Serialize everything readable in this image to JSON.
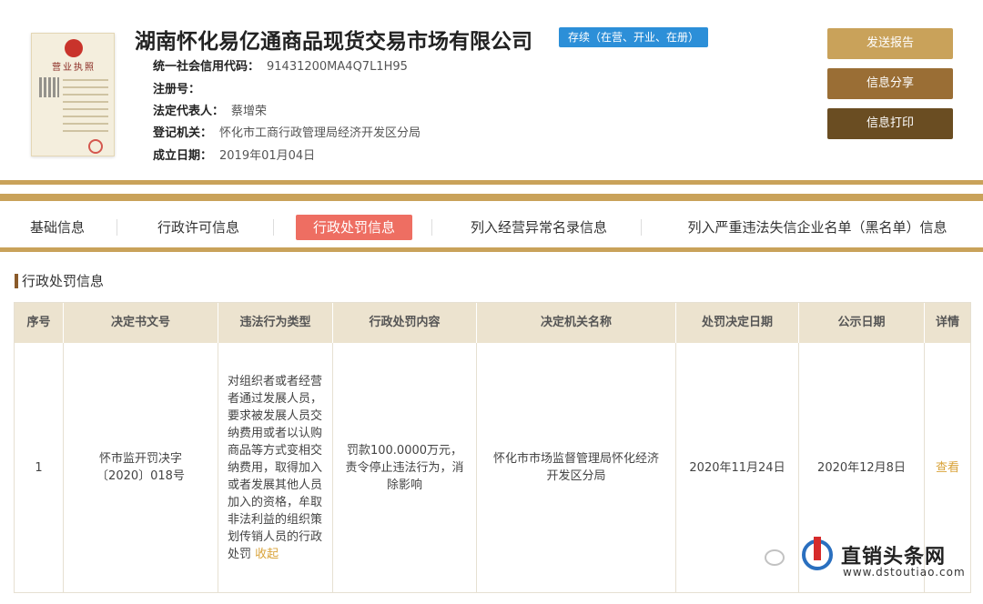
{
  "header": {
    "company_name": "湖南怀化易亿通商品现货交易市场有限公司",
    "status_badge": "存续（在营、开业、在册）",
    "license_title": "营业执照",
    "fields": [
      {
        "key": "统一社会信用代码：",
        "value": "91431200MA4Q7L1H95"
      },
      {
        "key": "注册号：",
        "value": ""
      },
      {
        "key": "法定代表人：",
        "value": "蔡增荣"
      },
      {
        "key": "登记机关：",
        "value": "怀化市工商行政管理局经济开发区分局"
      },
      {
        "key": "成立日期：",
        "value": "2019年01月04日"
      }
    ],
    "buttons": {
      "send": "发送报告",
      "share": "信息分享",
      "print": "信息打印"
    },
    "colors": {
      "gold": "#c9a25a",
      "badge": "#2c8fd8",
      "active_tab": "#ee6e62"
    }
  },
  "tabs": [
    {
      "label": "基础信息"
    },
    {
      "label": "行政许可信息"
    },
    {
      "label": "行政处罚信息"
    },
    {
      "label": "列入经营异常名录信息"
    },
    {
      "label": "列入严重违法失信企业名单（黑名单）信息"
    }
  ],
  "section": {
    "title": "行政处罚信息",
    "columns": [
      "序号",
      "决定书文号",
      "违法行为类型",
      "行政处罚内容",
      "决定机关名称",
      "处罚决定日期",
      "公示日期",
      "详情"
    ],
    "rows": [
      {
        "index": "1",
        "doc_no": "怀市监开罚决字〔2020〕018号",
        "violation": "对组织者或者经营者通过发展人员，要求被发展人员交纳费用或者以认购商品等方式变相交纳费用，取得加入或者发展其他人员加入的资格，牟取非法利益的组织策划传销人员的行政处罚",
        "violation_toggle": "收起",
        "penalty": "罚款100.0000万元，责令停止违法行为，消除影响",
        "authority": "怀化市市场监督管理局怀化经济开发区分局",
        "decision_date": "2020年11月24日",
        "publish_date": "2020年12月8日",
        "detail": "查看"
      }
    ]
  },
  "watermark": {
    "name": "直销头条网",
    "url": "www.dstoutiao.com"
  }
}
